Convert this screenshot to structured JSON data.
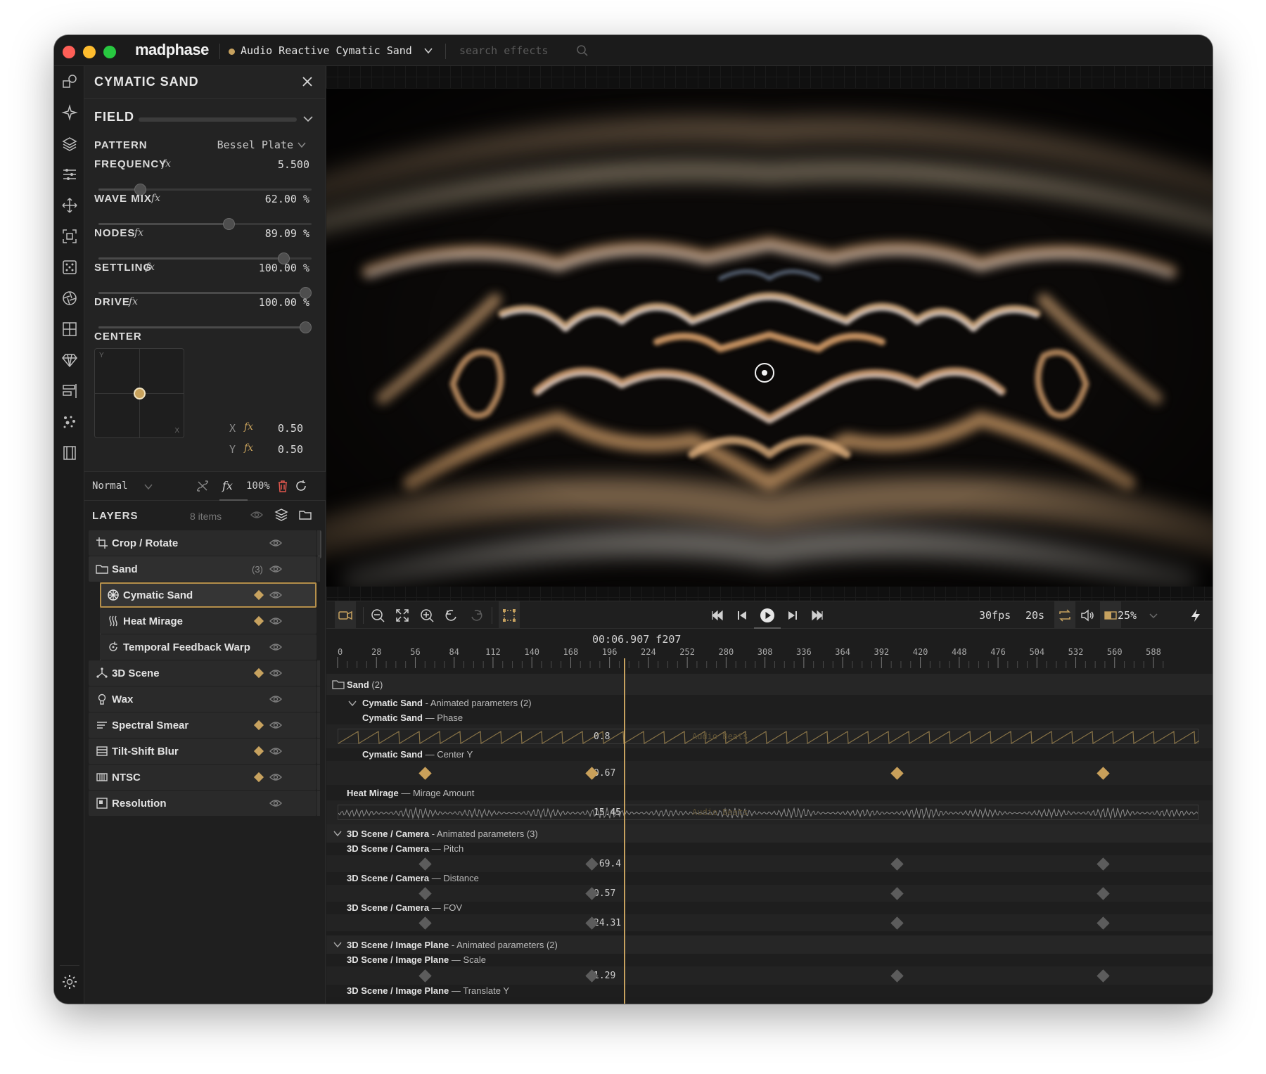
{
  "app": {
    "logo": "madphase",
    "project_name": "Audio Reactive Cymatic Sand",
    "search_placeholder": "search effects"
  },
  "colors": {
    "accent": "#c7a25f",
    "background": "#1d1d1d",
    "panel": "#232323",
    "traffic_red": "#fe5f57",
    "traffic_yellow": "#febc2e",
    "traffic_green": "#28c840",
    "delete_red": "#e0564d"
  },
  "rail_icons": [
    "shapes-icon",
    "sparkle-icon",
    "layers-stack-icon",
    "sliders-icon",
    "move-icon",
    "crop-frame-icon",
    "dice-icon",
    "aperture-icon",
    "grid-layout-icon",
    "gem-icon",
    "align-icon",
    "particles-icon",
    "film-icon"
  ],
  "rail_bottom_icons": [
    "settings-gear-icon",
    "book-icon"
  ],
  "properties": {
    "title": "CYMATIC SAND",
    "section": "FIELD",
    "pattern": {
      "label": "PATTERN",
      "value": "Bessel Plate"
    },
    "params": [
      {
        "label": "FREQUENCY",
        "fx": "fx",
        "value": "5.500",
        "fraction": 0.18
      },
      {
        "label": "WAVE MIX",
        "fx": "fx",
        "value": "62.00 %",
        "fraction": 0.62
      },
      {
        "label": "NODES",
        "fx": "fx",
        "value": "89.09 %",
        "fraction": 0.8909
      },
      {
        "label": "SETTLING",
        "fx": "fx",
        "value": "100.00 %",
        "fraction": 1.0
      },
      {
        "label": "DRIVE",
        "fx": "fx",
        "value": "100.00 %",
        "fraction": 1.0
      }
    ],
    "center": {
      "label": "CENTER",
      "axis_y": "Y",
      "axis_x": "X",
      "x_label": "X",
      "y_label": "Y",
      "fx": "fx",
      "x_value": "0.50",
      "y_value": "0.50"
    }
  },
  "blend": {
    "mode": "Normal",
    "fx": "fx",
    "opacity": "100%"
  },
  "layers": {
    "title": "LAYERS",
    "count": "8 items",
    "items": [
      {
        "name": "Crop / Rotate",
        "icon": "crop-icon",
        "keyframed": false,
        "count": ""
      },
      {
        "name": "Sand",
        "icon": "folder-icon",
        "keyframed": false,
        "count": "(3)"
      },
      {
        "name": "Cymatic Sand",
        "icon": "cymatic-icon",
        "keyframed": true,
        "count": ""
      },
      {
        "name": "Heat Mirage",
        "icon": "heat-wave-icon",
        "keyframed": true,
        "count": ""
      },
      {
        "name": "Temporal Feedback Warp",
        "icon": "feedback-icon",
        "keyframed": false,
        "count": ""
      },
      {
        "name": "3D Scene",
        "icon": "scene-3d-icon",
        "keyframed": true,
        "count": ""
      },
      {
        "name": "Wax",
        "icon": "wax-icon",
        "keyframed": false,
        "count": ""
      },
      {
        "name": "Spectral Smear",
        "icon": "smear-icon",
        "keyframed": true,
        "count": ""
      },
      {
        "name": "Tilt-Shift Blur",
        "icon": "blur-icon",
        "keyframed": true,
        "count": ""
      },
      {
        "name": "NTSC",
        "icon": "ntsc-icon",
        "keyframed": true,
        "count": ""
      },
      {
        "name": "Resolution",
        "icon": "resolution-icon",
        "keyframed": false,
        "count": ""
      }
    ]
  },
  "transport": {
    "fps": "30fps",
    "duration": "20s",
    "zoom": "25%"
  },
  "timeline": {
    "timecode": "00:06.907 f207",
    "ticks": [
      "0",
      "28",
      "56",
      "84",
      "112",
      "140",
      "168",
      "196",
      "224",
      "252",
      "280",
      "308",
      "336",
      "364",
      "392",
      "420",
      "448",
      "476",
      "504",
      "532",
      "560",
      "588"
    ],
    "tick_frames": [
      0,
      28,
      56,
      84,
      112,
      140,
      168,
      196,
      224,
      252,
      280,
      308,
      336,
      364,
      392,
      420,
      448,
      476,
      504,
      532,
      560,
      588
    ],
    "playhead_frame": 207,
    "group_sand": {
      "name": "Sand",
      "count": "(2)"
    },
    "sub_cymatic": {
      "name": "Cymatic Sand",
      "suffix": "- Animated parameters (2)"
    },
    "tracks": [
      {
        "owner": "Cymatic Sand",
        "param": "— Phase",
        "value": "0.8",
        "overlay": "Audio Beats"
      },
      {
        "owner": "Cymatic Sand",
        "param": "— Center Y",
        "value": "0.67",
        "keyframe_frames": [
          63,
          183,
          403,
          552
        ]
      },
      {
        "owner": "Heat Mirage",
        "param": "— Mirage Amount",
        "value": "15.45",
        "overlay": "Audio Beats"
      },
      {
        "owner": "3D Scene / Camera",
        "param": "— Pitch",
        "value": "-69.4",
        "keyframe_frames": [
          63,
          183,
          403,
          552
        ]
      },
      {
        "owner": "3D Scene / Camera",
        "param": "— Distance",
        "value": "0.57",
        "keyframe_frames": [
          63,
          183,
          403,
          552
        ]
      },
      {
        "owner": "3D Scene / Camera",
        "param": "— FOV",
        "value": "24.31",
        "keyframe_frames": [
          63,
          183,
          403,
          552
        ]
      },
      {
        "owner": "3D Scene / Image Plane",
        "param": "— Scale",
        "value": "1.29",
        "keyframe_frames": [
          63,
          183,
          403,
          552
        ]
      },
      {
        "owner": "3D Scene / Image Plane",
        "param": "— Translate Y",
        "value": ""
      }
    ],
    "group_camera": {
      "name": "3D Scene / Camera",
      "suffix": "- Animated parameters (3)"
    },
    "group_plane": {
      "name": "3D Scene / Image Plane",
      "suffix": "- Animated parameters (2)"
    }
  }
}
